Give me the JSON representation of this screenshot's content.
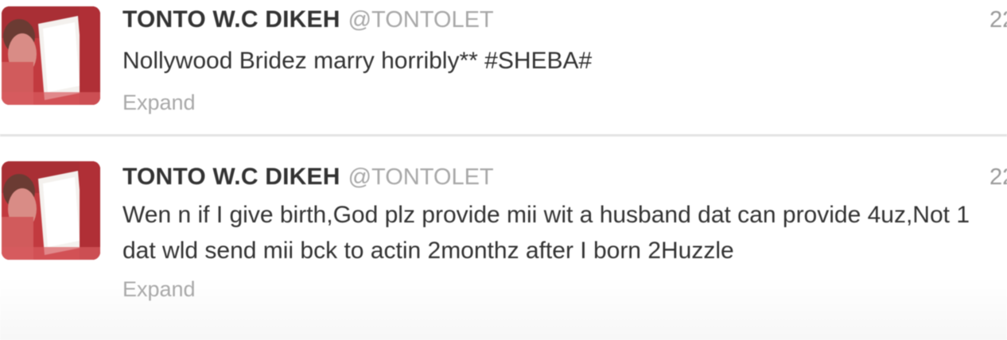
{
  "timeline": {
    "tweets": [
      {
        "fullname": "TONTO W.C DIKEH",
        "username": "@TONTOLET",
        "timestamp": "22",
        "text": "Nollywood Bridez marry horribly** #SHEBA#",
        "expand_label": "Expand",
        "avatar_icon": "profile-photo-icon"
      },
      {
        "fullname": "TONTO W.C DIKEH",
        "username": "@TONTOLET",
        "timestamp": "22",
        "text": "Wen n if I give birth,God plz provide mii wit a husband dat can provide 4uz,Not 1 dat wld send mii bck to actin 2monthz after I born 2Huzzle",
        "expand_label": "Expand",
        "avatar_icon": "profile-photo-icon"
      }
    ]
  },
  "colors": {
    "name_text": "#333333",
    "username_text": "#a8a8a8",
    "expand_link": "#a9a9a9",
    "divider": "#e7e7e7",
    "avatar_accent": "#b8383a"
  }
}
